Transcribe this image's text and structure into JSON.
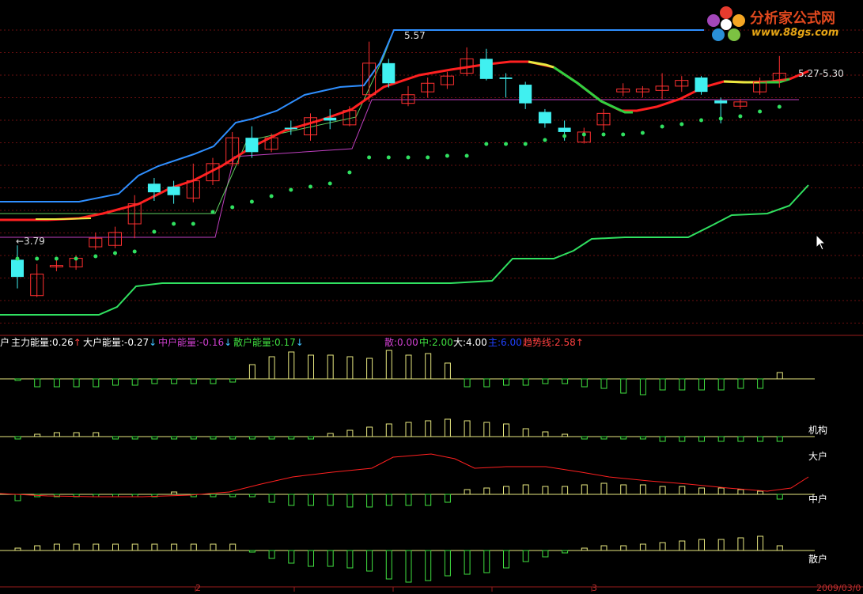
{
  "logo": {
    "title": "分析家公式网",
    "url": "www.88gs.com"
  },
  "price_panel": {
    "high_label": "5.57",
    "low_label": "←3.79",
    "range_label": "5.27-5.30"
  },
  "indicator_header": {
    "prefix": "户",
    "items": [
      {
        "text": "主力能量:0.26",
        "arrow": "↑",
        "color": "#ffffff",
        "arrow_color": "#ff4040"
      },
      {
        "text": "大户能量:-0.27",
        "arrow": "↓",
        "color": "#ffffff",
        "arrow_color": "#40c0ff"
      },
      {
        "text": "中户能量:-0.16",
        "arrow": "↓",
        "color": "#d040d0",
        "arrow_color": "#40c0ff"
      },
      {
        "text": "散户能量:0.17",
        "arrow": "↓",
        "color": "#40e040",
        "arrow_color": "#40c0ff"
      }
    ],
    "legend": [
      {
        "text": "散:0.00",
        "color": "#d040d0"
      },
      {
        "text": "中:2.00",
        "color": "#40e040"
      },
      {
        "text": "大:4.00",
        "color": "#ffffff"
      },
      {
        "text": "主:6.00",
        "color": "#2040ff"
      },
      {
        "text": "趋势线:2.58",
        "color": "#ff4040"
      }
    ],
    "trend_arrow": "↑"
  },
  "row_labels": {
    "jigou": "机构",
    "dahu": "大户",
    "zhonghu": "中户",
    "sanhu": "散户"
  },
  "bottom_axis": {
    "left_date": "2",
    "mid_date": "3",
    "right_date": "2009/03/0"
  },
  "chart_data": {
    "type": "candlestick",
    "title": "",
    "candles": [
      {
        "o": 4.05,
        "c": 3.93,
        "h": 4.15,
        "l": 3.85
      },
      {
        "o": 3.8,
        "c": 3.95,
        "h": 4.02,
        "l": 3.79
      },
      {
        "o": 4.0,
        "c": 4.01,
        "h": 4.05,
        "l": 3.97
      },
      {
        "o": 4.0,
        "c": 4.06,
        "h": 4.08,
        "l": 3.98
      },
      {
        "o": 4.14,
        "c": 4.2,
        "h": 4.24,
        "l": 4.12
      },
      {
        "o": 4.15,
        "c": 4.24,
        "h": 4.28,
        "l": 4.13
      },
      {
        "o": 4.3,
        "c": 4.44,
        "h": 4.5,
        "l": 4.2
      },
      {
        "o": 4.58,
        "c": 4.52,
        "h": 4.62,
        "l": 4.46
      },
      {
        "o": 4.56,
        "c": 4.5,
        "h": 4.6,
        "l": 4.44
      },
      {
        "o": 4.48,
        "c": 4.6,
        "h": 4.72,
        "l": 4.45
      },
      {
        "o": 4.6,
        "c": 4.72,
        "h": 4.76,
        "l": 4.57
      },
      {
        "o": 4.72,
        "c": 4.9,
        "h": 4.94,
        "l": 4.7
      },
      {
        "o": 4.9,
        "c": 4.8,
        "h": 4.98,
        "l": 4.76
      },
      {
        "o": 4.82,
        "c": 4.9,
        "h": 4.93,
        "l": 4.8
      },
      {
        "o": 4.97,
        "c": 4.96,
        "h": 5.02,
        "l": 4.92
      },
      {
        "o": 4.92,
        "c": 5.04,
        "h": 5.07,
        "l": 4.88
      },
      {
        "o": 5.04,
        "c": 5.02,
        "h": 5.1,
        "l": 4.96
      },
      {
        "o": 4.99,
        "c": 5.09,
        "h": 5.12,
        "l": 4.98
      },
      {
        "o": 5.2,
        "c": 5.42,
        "h": 5.57,
        "l": 5.15
      },
      {
        "o": 5.42,
        "c": 5.28,
        "h": 5.45,
        "l": 5.25
      },
      {
        "o": 5.14,
        "c": 5.2,
        "h": 5.26,
        "l": 5.12
      },
      {
        "o": 5.22,
        "c": 5.28,
        "h": 5.32,
        "l": 5.18
      },
      {
        "o": 5.27,
        "c": 5.33,
        "h": 5.36,
        "l": 5.24
      },
      {
        "o": 5.35,
        "c": 5.45,
        "h": 5.53,
        "l": 5.33
      },
      {
        "o": 5.45,
        "c": 5.31,
        "h": 5.52,
        "l": 5.3
      },
      {
        "o": 5.32,
        "c": 5.31,
        "h": 5.35,
        "l": 5.18
      },
      {
        "o": 5.27,
        "c": 5.14,
        "h": 5.29,
        "l": 5.1
      },
      {
        "o": 5.08,
        "c": 5.0,
        "h": 5.1,
        "l": 4.97
      },
      {
        "o": 4.97,
        "c": 4.94,
        "h": 5.02,
        "l": 4.88
      },
      {
        "o": 4.87,
        "c": 4.94,
        "h": 4.97,
        "l": 4.86
      },
      {
        "o": 4.99,
        "c": 5.07,
        "h": 5.1,
        "l": 4.95
      },
      {
        "o": 5.22,
        "c": 5.24,
        "h": 5.28,
        "l": 5.19
      },
      {
        "o": 5.22,
        "c": 5.24,
        "h": 5.26,
        "l": 5.18
      },
      {
        "o": 5.23,
        "c": 5.26,
        "h": 5.35,
        "l": 5.17
      },
      {
        "o": 5.26,
        "c": 5.3,
        "h": 5.33,
        "l": 5.22
      },
      {
        "o": 5.32,
        "c": 5.22,
        "h": 5.33,
        "l": 5.2
      },
      {
        "o": 5.16,
        "c": 5.14,
        "h": 5.18,
        "l": 5.0
      },
      {
        "o": 5.12,
        "c": 5.15,
        "h": 5.17,
        "l": 5.1
      },
      {
        "o": 5.22,
        "c": 5.29,
        "h": 5.32,
        "l": 5.2
      },
      {
        "o": 5.3,
        "c": 5.35,
        "h": 5.47,
        "l": 5.25
      }
    ],
    "price_axis": {
      "min": 3.6,
      "max": 5.75
    },
    "series_notes": [
      "trend line (red/green/yellow)",
      "resistance line (blue)",
      "support dots (green)",
      "support line (green)"
    ],
    "bottom_rows": [
      "主力能量",
      "机构",
      "大户/中户",
      "散户"
    ]
  }
}
